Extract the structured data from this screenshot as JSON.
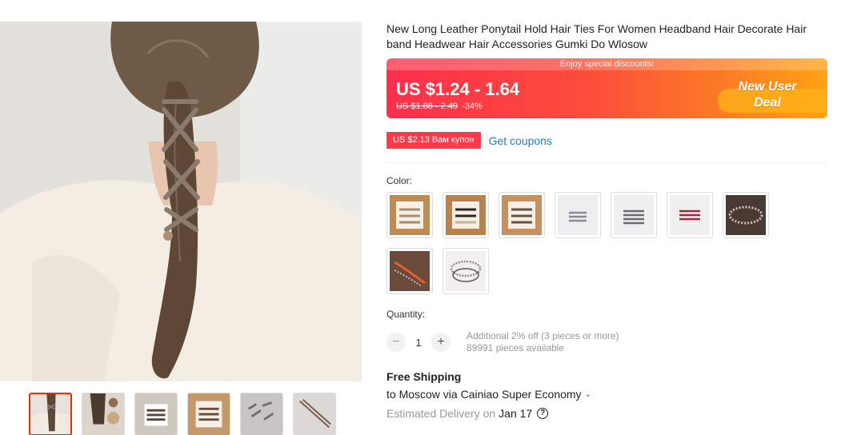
{
  "product": {
    "title": "New Long Leather Ponytail Hold Hair Ties For Women Headband Hair Decorate Hair band Headwear Hair Accessories Gumki Do Wlosow"
  },
  "banner": {
    "top_text": "Enjoy special discounts!",
    "price_range": "US $1.24 - 1.64",
    "old_price": "US $1.88 - 2.49",
    "discount": "-34%",
    "deal_line1": "New User",
    "deal_line2": "Deal",
    "gradient_start": "#fe2f4d",
    "gradient_end": "#ffa313"
  },
  "coupon": {
    "tag": "US $2.13 Вам купон",
    "link": "Get coupons",
    "tag_color": "#fc3a4a",
    "link_color": "#2e78b7"
  },
  "color": {
    "label": "Color:",
    "options": [
      "brown-beige-ties",
      "black-beige-ties",
      "brown-ties",
      "grey-clips",
      "dark-grey-clips",
      "red-clips",
      "studded-band",
      "orange-bead-band",
      "silver-bead-band"
    ]
  },
  "quantity": {
    "label": "Quantity:",
    "value": "1",
    "minus": "−",
    "plus": "+",
    "note_line1": "Additional 2% off (3 pieces or more)",
    "note_line2": "89991 pieces available"
  },
  "shipping": {
    "title": "Free Shipping",
    "route": "to Moscow via Cainiao Super Economy",
    "delivery_label": "Estimated Delivery on",
    "delivery_date": "Jan 17",
    "help": "?"
  },
  "gallery": {
    "thumbs": [
      "ponytail-back",
      "ponytail-side",
      "ties-set-1",
      "ties-set-2",
      "clips-set",
      "headband-brown"
    ],
    "active_index": 0
  }
}
